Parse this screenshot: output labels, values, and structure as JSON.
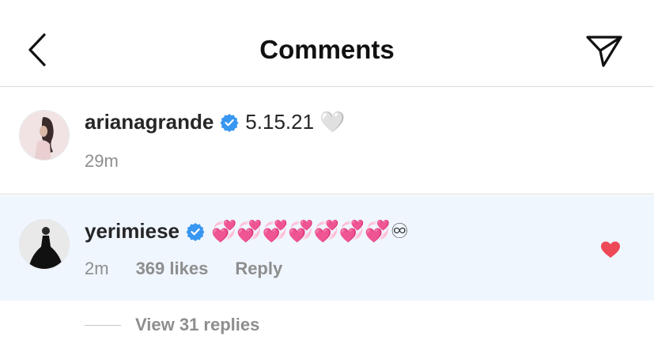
{
  "header": {
    "title": "Comments",
    "back_icon": "chevron-left-icon",
    "send_icon": "paper-plane-icon"
  },
  "caption": {
    "username": "arianagrande",
    "verified": true,
    "text": "5.15.21 🤍",
    "time": "29m"
  },
  "comment": {
    "username": "yerimiese",
    "verified": true,
    "text": "💞💞💞💞💞💞💞♾",
    "time": "2m",
    "likes": "369 likes",
    "reply_label": "Reply",
    "liked": true
  },
  "replies": {
    "label": "View 31 replies"
  },
  "colors": {
    "verified_blue": "#3897f0",
    "like_red": "#ed4956",
    "comment_highlight_bg": "#eff6fe",
    "meta_gray": "#8e8e8e"
  }
}
